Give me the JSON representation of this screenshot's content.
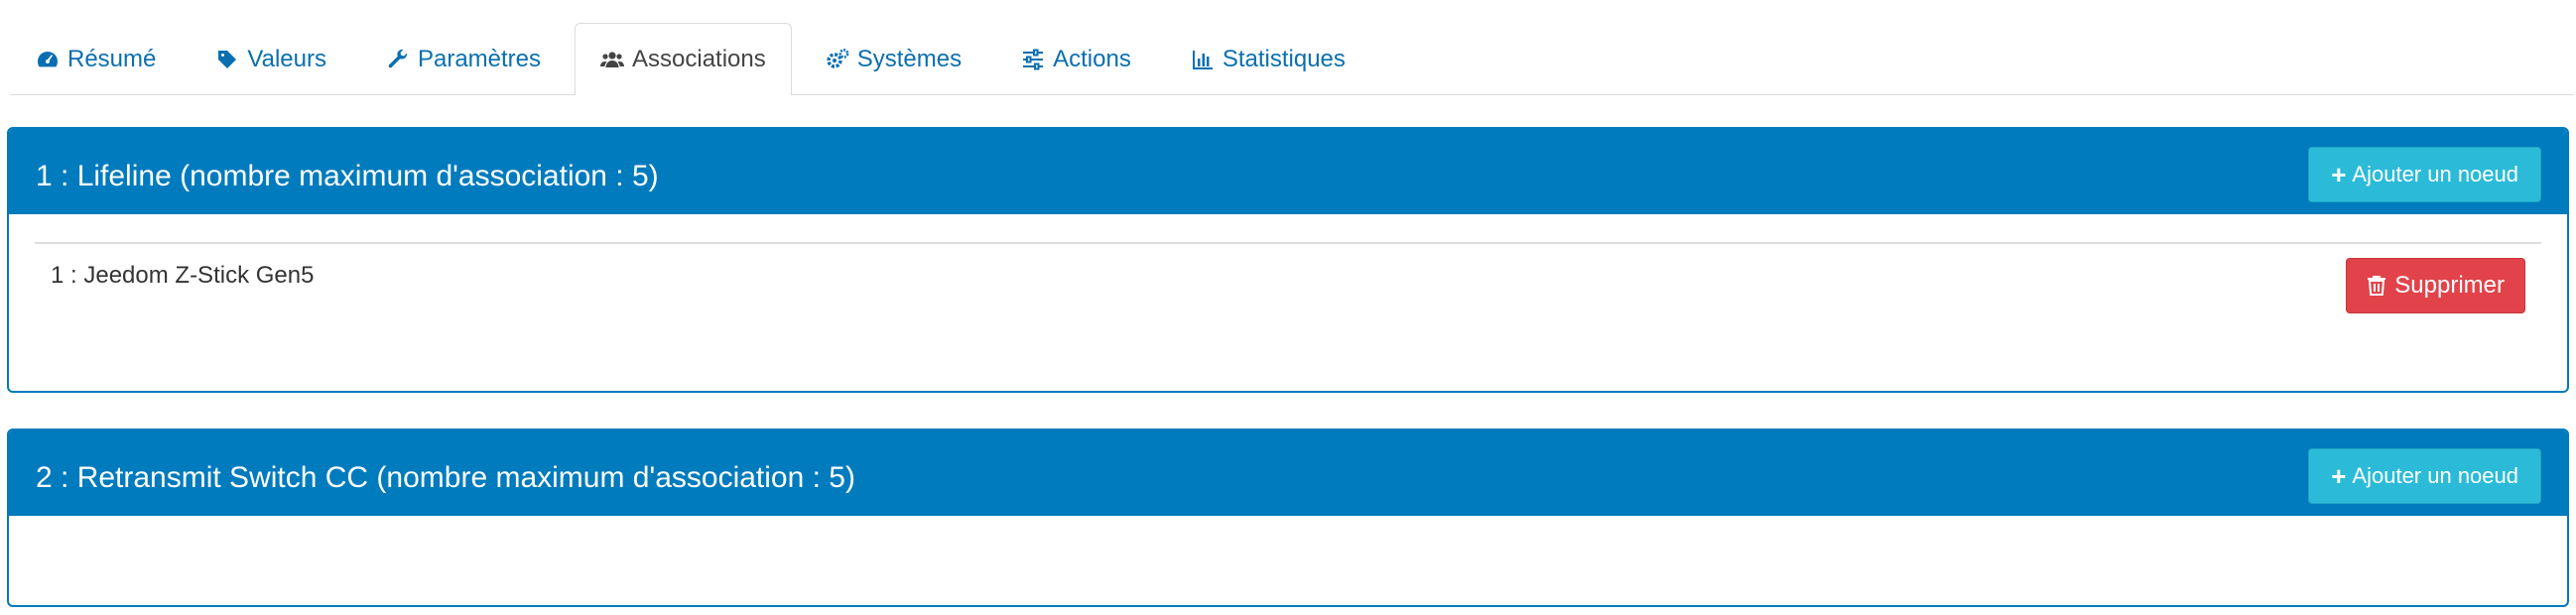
{
  "tabs": [
    {
      "label": "Résumé",
      "icon": "dashboard-icon",
      "active": false
    },
    {
      "label": "Valeurs",
      "icon": "tag-icon",
      "active": false
    },
    {
      "label": "Paramètres",
      "icon": "wrench-icon",
      "active": false
    },
    {
      "label": "Associations",
      "icon": "users-icon",
      "active": true
    },
    {
      "label": "Systèmes",
      "icon": "gears-icon",
      "active": false
    },
    {
      "label": "Actions",
      "icon": "sliders-icon",
      "active": false
    },
    {
      "label": "Statistiques",
      "icon": "bar-chart-icon",
      "active": false
    }
  ],
  "groups": [
    {
      "title": "1 : Lifeline (nombre maximum d'association : 5)",
      "add_label": "Ajouter un noeud",
      "nodes": [
        {
          "label": "1 : Jeedom Z-Stick Gen5",
          "delete_label": "Supprimer"
        }
      ]
    },
    {
      "title": "2 : Retransmit Switch CC (nombre maximum d'association : 5)",
      "add_label": "Ajouter un noeud",
      "nodes": []
    }
  ],
  "colors": {
    "primary": "#007bbd",
    "info": "#2bbbd8",
    "danger": "#e2434b",
    "link": "#0a6fb0"
  }
}
